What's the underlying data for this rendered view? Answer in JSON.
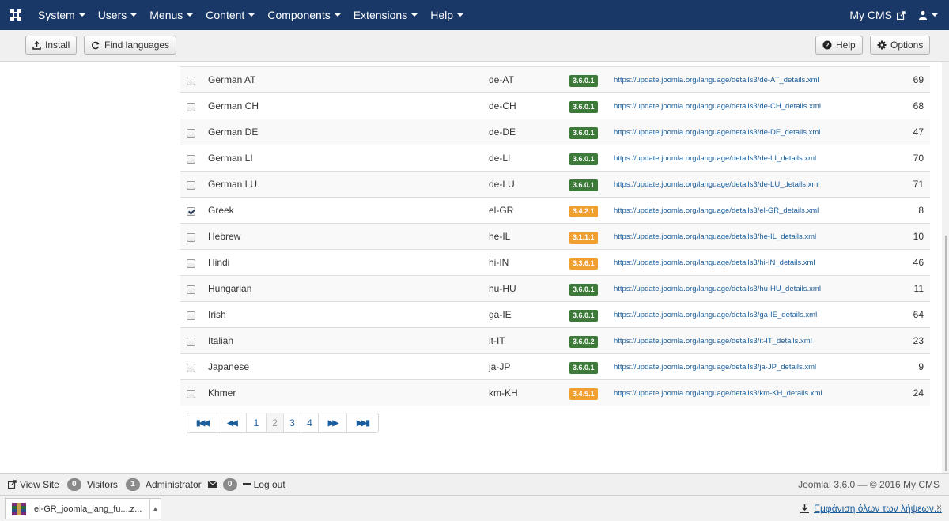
{
  "navbar": {
    "menus": [
      "System",
      "Users",
      "Menus",
      "Content",
      "Components",
      "Extensions",
      "Help"
    ],
    "site_link": "My CMS"
  },
  "toolbar": {
    "install_label": "Install",
    "find_languages_label": "Find languages",
    "help_label": "Help",
    "options_label": "Options"
  },
  "languages": [
    {
      "name": "German AT",
      "tag": "de-AT",
      "version": "3.6.0.1",
      "version_color": "#3d7a3a",
      "url": "https://update.joomla.org/language/details3/de-AT_details.xml",
      "id": "69",
      "checked": false
    },
    {
      "name": "German CH",
      "tag": "de-CH",
      "version": "3.6.0.1",
      "version_color": "#3d7a3a",
      "url": "https://update.joomla.org/language/details3/de-CH_details.xml",
      "id": "68",
      "checked": false
    },
    {
      "name": "German DE",
      "tag": "de-DE",
      "version": "3.6.0.1",
      "version_color": "#3d7a3a",
      "url": "https://update.joomla.org/language/details3/de-DE_details.xml",
      "id": "47",
      "checked": false
    },
    {
      "name": "German LI",
      "tag": "de-LI",
      "version": "3.6.0.1",
      "version_color": "#3d7a3a",
      "url": "https://update.joomla.org/language/details3/de-LI_details.xml",
      "id": "70",
      "checked": false
    },
    {
      "name": "German LU",
      "tag": "de-LU",
      "version": "3.6.0.1",
      "version_color": "#3d7a3a",
      "url": "https://update.joomla.org/language/details3/de-LU_details.xml",
      "id": "71",
      "checked": false
    },
    {
      "name": "Greek",
      "tag": "el-GR",
      "version": "3.4.2.1",
      "version_color": "#f0a030",
      "url": "https://update.joomla.org/language/details3/el-GR_details.xml",
      "id": "8",
      "checked": true
    },
    {
      "name": "Hebrew",
      "tag": "he-IL",
      "version": "3.1.1.1",
      "version_color": "#f0a030",
      "url": "https://update.joomla.org/language/details3/he-IL_details.xml",
      "id": "10",
      "checked": false
    },
    {
      "name": "Hindi",
      "tag": "hi-IN",
      "version": "3.3.6.1",
      "version_color": "#f0a030",
      "url": "https://update.joomla.org/language/details3/hi-IN_details.xml",
      "id": "46",
      "checked": false
    },
    {
      "name": "Hungarian",
      "tag": "hu-HU",
      "version": "3.6.0.1",
      "version_color": "#3d7a3a",
      "url": "https://update.joomla.org/language/details3/hu-HU_details.xml",
      "id": "11",
      "checked": false
    },
    {
      "name": "Irish",
      "tag": "ga-IE",
      "version": "3.6.0.1",
      "version_color": "#3d7a3a",
      "url": "https://update.joomla.org/language/details3/ga-IE_details.xml",
      "id": "64",
      "checked": false
    },
    {
      "name": "Italian",
      "tag": "it-IT",
      "version": "3.6.0.2",
      "version_color": "#3d7a3a",
      "url": "https://update.joomla.org/language/details3/it-IT_details.xml",
      "id": "23",
      "checked": false
    },
    {
      "name": "Japanese",
      "tag": "ja-JP",
      "version": "3.6.0.1",
      "version_color": "#3d7a3a",
      "url": "https://update.joomla.org/language/details3/ja-JP_details.xml",
      "id": "9",
      "checked": false
    },
    {
      "name": "Khmer",
      "tag": "km-KH",
      "version": "3.4.5.1",
      "version_color": "#f0a030",
      "url": "https://update.joomla.org/language/details3/km-KH_details.xml",
      "id": "24",
      "checked": false
    }
  ],
  "pagination": {
    "pages": [
      "1",
      "2",
      "3",
      "4"
    ],
    "current": "2"
  },
  "statusbar": {
    "view_site": "View Site",
    "visitors_count": "0",
    "visitors_label": "Visitors",
    "admin_count": "1",
    "admin_label": "Administrator",
    "messages_count": "0",
    "logout_label": "Log out",
    "version_text": "Joomla! 3.6.0 — © 2016 My CMS"
  },
  "downloads": {
    "file_name": "el-GR_joomla_lang_fu....z...",
    "show_all": "Εμφάνιση όλων των λήψεων...",
    "close": "×"
  },
  "colors": {
    "navbar_bg": "#1a3867",
    "link": "#1a5d9a",
    "version_current": "#3d7a3a",
    "version_outdated": "#f0a030"
  }
}
